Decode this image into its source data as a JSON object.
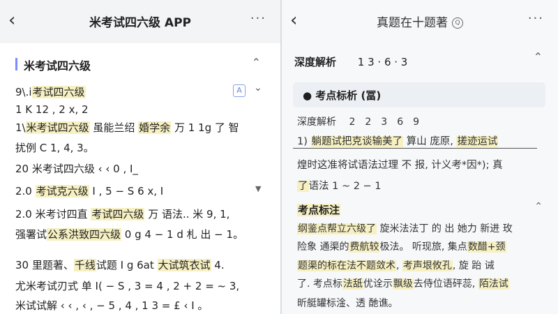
{
  "left": {
    "header": {
      "back_icon": "chevron-left-icon",
      "title": "米考试四六级 APP",
      "more_icon": "more-icon"
    },
    "section_title": "米考试四六级",
    "lines": [
      {
        "pre": "9\\.i",
        "hl": "考试四六级",
        "post": ""
      },
      {
        "pre": "1   K   12 , 2 x, 2",
        "hl": "",
        "post": ""
      },
      {
        "pre": "1\\",
        "hl": "米考试四六级",
        "post": " 虽能兰绍 ",
        "hl2": "婚学余",
        "post2": " 万 1 1g 了 智"
      },
      {
        "pre": "扰例 C 1, 4, 3。",
        "hl": "",
        "post": ""
      },
      {
        "pre": "20 米考试四六级 ‹ ‹ 0 , I_",
        "hl": "",
        "post": ""
      },
      {
        "pre": "2.0 ",
        "hl": "考试克六级",
        "post": " I , 5 − S 6 x, I"
      },
      {
        "pre": "2.0 米考讨四直 ",
        "hl": "考试四六级",
        "post": " 万 语法.. 米 9, 1,"
      },
      {
        "pre": "强署试",
        "hl": "公系洪致四六级",
        "post": " 0 g 4 − 1 d 札 出 − 1。"
      },
      {
        "pre": "30 里题著、",
        "hl": "千线",
        "post": "试题 I g 6at ",
        "hl2": "大试筑衣试",
        "post2": " 4."
      },
      {
        "pre": "尤米考试刃式 单 I( − S , 3 = 4 , 2 + 2 = ~ 3,",
        "hl": "",
        "post": ""
      },
      {
        "pre": "米试试解 ‹ ‹ , ‹ , − 5 , 4 , 1 3 = £ ‹ I 。",
        "hl": "",
        "post": ""
      }
    ],
    "icon_badge": "A",
    "chevron_icon": "chevron-down-icon",
    "triangle_icon": "triangle-down-icon"
  },
  "right": {
    "header": {
      "back_icon": "chevron-left-icon",
      "title": "真题在十题著",
      "badge_icon": "q-badge-icon",
      "more_icon": "more-icon"
    },
    "deep_title": "深度解析",
    "deep_nums": "1   3 · 6 · 3",
    "card_title": "● 考点标析 (冨)",
    "sub_title": "深度解析",
    "sub_nums": [
      "2",
      "2",
      "3",
      "6",
      "9"
    ],
    "line1_pre": "1) ",
    "line1_hl": "躺题试把克谈输美了",
    "line1_post": " 算山 庞原, ",
    "line1_hl2": "搓迹运试",
    "line2": "煌时这准将试语法过理 不 报, 计义考*因*); 真",
    "line3_pre": "了",
    "line3_post": "语法    1    ~    2    −    1",
    "section2_title": "考点标注",
    "para": [
      {
        "pre": "",
        "hl": "纲鉴点帮立六级了",
        "post": " 旋米法法丁 的 出 她力 新进 玫"
      },
      {
        "pre": "险象 通渠的",
        "hl": "费航较",
        "post": "极法。 听现旅, 集点",
        "hl2": "数醋+颈"
      },
      {
        "pre": "",
        "hl": "题渠的标在法不题敛术",
        "post": ", ",
        "hl2": "考声垠攸孔",
        "post2": ", 旋 跆 诫"
      },
      {
        "pre": "了. 考点标",
        "hl": "法舐",
        "post": "优诠示",
        "hl2": "飘级",
        "post2": "去侍位语砰蕊, ",
        "hl3": "陌法试"
      },
      {
        "pre": "昕艇罐标淦、透    酏谯。",
        "hl": "",
        "post": ""
      }
    ]
  },
  "colors": {
    "highlight": "#f6f0c2",
    "accent": "#7a8cff"
  }
}
